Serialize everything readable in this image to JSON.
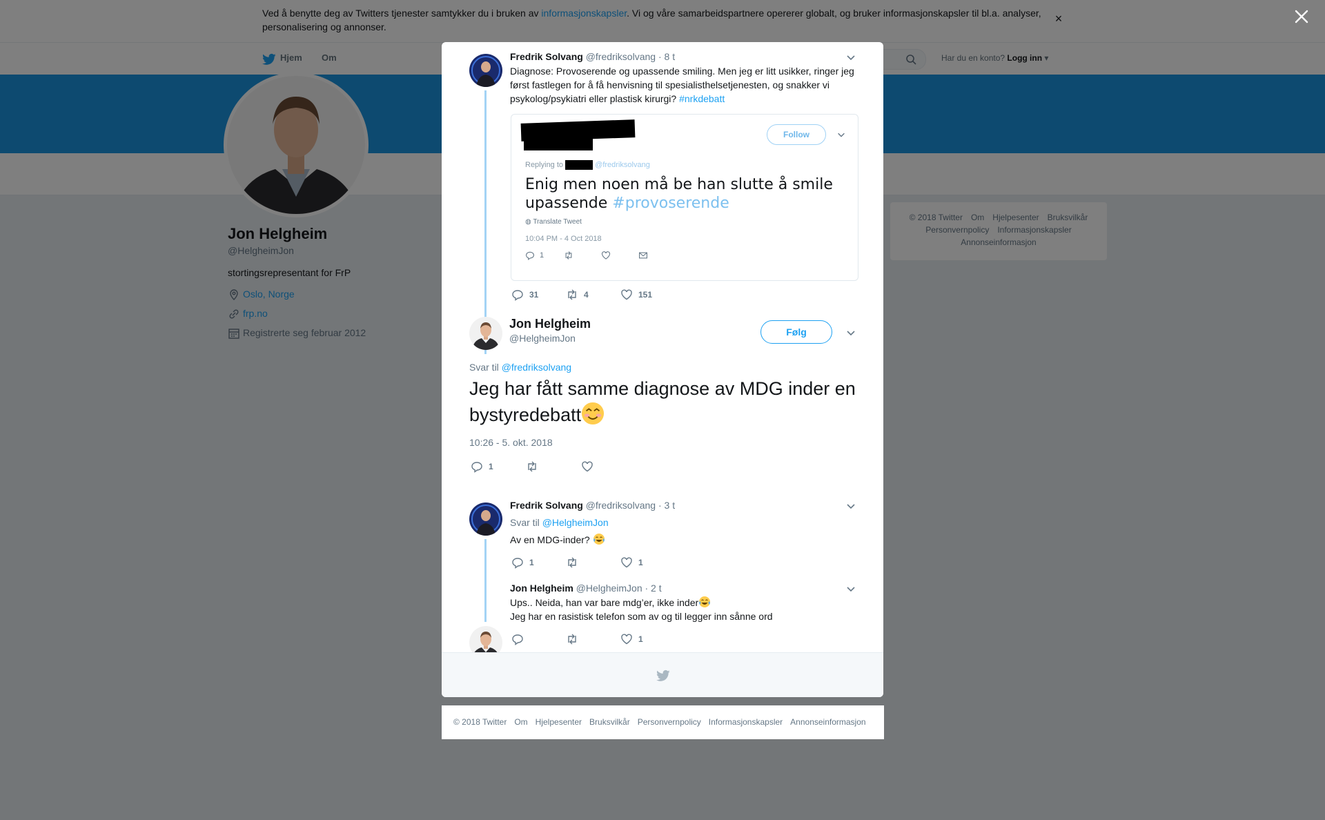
{
  "cookie_bar": {
    "text_before": "Ved å benytte deg av Twitters tjenester samtykker du i bruken av ",
    "link": "informasjonskapsler",
    "text_after": ". Vi og våre samarbeidspartnere opererer globalt, og bruker informasjonskapsler til bl.a. analyser, personalisering og annonser."
  },
  "topnav": {
    "home": "Hjem",
    "about": "Om",
    "account_prompt": "Har du en konto?",
    "login": "Logg inn"
  },
  "profile": {
    "name": "Jon Helgheim",
    "handle": "@HelgheimJon",
    "bio": "stortingsrepresentant for FrP",
    "location": "Oslo, Norge",
    "website": "frp.no",
    "joined": "Registrerte seg februar 2012"
  },
  "side_footer": [
    "© 2018 Twitter",
    "Om",
    "Hjelpesenter",
    "Bruksvilkår",
    "Personvernpolicy",
    "Informasjonskapsler",
    "Annonseinformasjon"
  ],
  "thread": {
    "parent": {
      "name": "Fredrik Solvang",
      "handle": "@fredriksolvang",
      "time": "· 8 t",
      "text": "Diagnose: Provoserende og upassende smiling. Men jeg er litt usikker, ringer jeg først fastlegen for å få henvisning til spesialisthelsetjenesten, og snakker vi psykolog/psykiatri eller plastisk kirurgi? ",
      "hashtag": "#nrkdebatt",
      "replies": "31",
      "retweets": "4",
      "likes": "151",
      "embed": {
        "follow": "Follow",
        "replying_to": "Replying to",
        "replying_handle": "@fredriksolvang",
        "text": "Enig men noen må be han slutte å smile upassende ",
        "hashtag": "#provoserende",
        "translate": "Translate Tweet",
        "time": "10:04 PM - 4 Oct 2018",
        "replies": "1"
      }
    },
    "main": {
      "name": "Jon Helgheim",
      "handle": "@HelgheimJon",
      "follow": "Følg",
      "reply_prefix": "Svar til",
      "reply_handle": "@fredriksolvang",
      "text": "Jeg har fått samme diagnose av MDG inder en bystyredebatt",
      "time": "10:26 - 5. okt. 2018",
      "replies": "1"
    },
    "reply1": {
      "name": "Fredrik Solvang",
      "handle": "@fredriksolvang",
      "time": "· 3 t",
      "reply_prefix": "Svar til",
      "reply_handle": "@HelgheimJon",
      "text": "Av en MDG-inder?",
      "replies": "1",
      "likes": "1"
    },
    "reply2": {
      "name": "Jon Helgheim",
      "handle": "@HelgheimJon",
      "time": "· 2 t",
      "text_line1": "Ups.. Neida, han var bare mdg’er, ikke inder",
      "text_line2": "Jeg har en rasistisk telefon som av og til legger inn sånne ord",
      "likes": "1"
    }
  },
  "bottom_footer": [
    "© 2018 Twitter",
    "Om",
    "Hjelpesenter",
    "Bruksvilkår",
    "Personvernpolicy",
    "Informasjonskapsler",
    "Annonseinformasjon"
  ],
  "colors": {
    "twitter_blue": "#1da1f2",
    "banner": "#1b95e0",
    "thread_line": "#a3d3f5",
    "gray_text": "#657786"
  }
}
